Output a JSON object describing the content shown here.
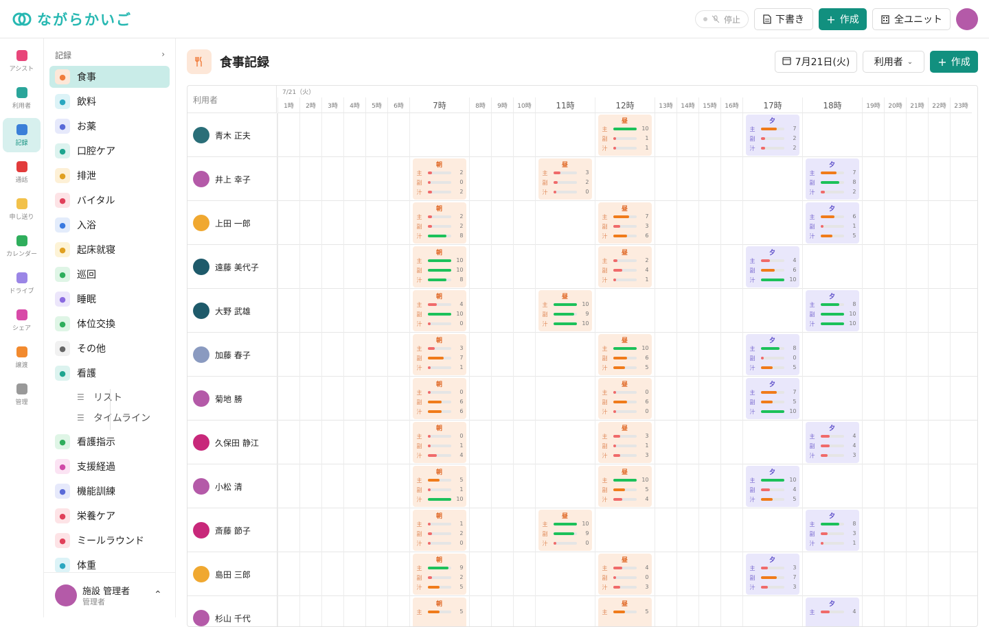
{
  "app": {
    "name": "ながらかいご"
  },
  "topbar": {
    "stop_label": "停止",
    "draft_label": "下書き",
    "create_label": "作成",
    "unit_label": "全ユニット"
  },
  "rail": [
    {
      "label": "アシスト",
      "icon": "heart-icon",
      "color": "#e8467a"
    },
    {
      "label": "利用者",
      "icon": "users-icon",
      "color": "#2aa59a"
    },
    {
      "label": "記録",
      "icon": "clipboard-icon",
      "color": "#3b7fd8",
      "active": true
    },
    {
      "label": "通話",
      "icon": "phone-icon",
      "color": "#e23b3b"
    },
    {
      "label": "申し送り",
      "icon": "chat-icon",
      "color": "#f2c14a"
    },
    {
      "label": "カレンダー",
      "icon": "calendar-icon",
      "color": "#2fae5c"
    },
    {
      "label": "ドライブ",
      "icon": "folder-icon",
      "color": "#9b86e6"
    },
    {
      "label": "シェア",
      "icon": "share-icon",
      "color": "#d84aa8"
    },
    {
      "label": "譲渡",
      "icon": "box-icon",
      "color": "#f28a2e"
    },
    {
      "label": "管理",
      "icon": "gear-icon",
      "color": "#999999"
    }
  ],
  "menu": {
    "header": "記録",
    "items": [
      {
        "label": "食事",
        "icon": "fork-knife-icon",
        "bg": "#fde7d8",
        "fg": "#f07b3a",
        "active": true
      },
      {
        "label": "飲料",
        "icon": "cup-icon",
        "bg": "#dcf3f7",
        "fg": "#2aa7c0"
      },
      {
        "label": "お薬",
        "icon": "pill-icon",
        "bg": "#e6e9fb",
        "fg": "#5a6ad8"
      },
      {
        "label": "口腔ケア",
        "icon": "toothbrush-icon",
        "bg": "#dcf3ef",
        "fg": "#1ea58f"
      },
      {
        "label": "排泄",
        "icon": "toilet-icon",
        "bg": "#fdf0d6",
        "fg": "#e0a020"
      },
      {
        "label": "バイタル",
        "icon": "heart-pulse-icon",
        "bg": "#fde3e6",
        "fg": "#e0405a"
      },
      {
        "label": "入浴",
        "icon": "bath-icon",
        "bg": "#e3ecfb",
        "fg": "#3a7ae0"
      },
      {
        "label": "起床就寝",
        "icon": "sunrise-icon",
        "bg": "#fdf3d6",
        "fg": "#e0a020"
      },
      {
        "label": "巡回",
        "icon": "shield-icon",
        "bg": "#dff5e6",
        "fg": "#2fae5c"
      },
      {
        "label": "睡眠",
        "icon": "moon-icon",
        "bg": "#ece6fb",
        "fg": "#8a6ae0"
      },
      {
        "label": "体位交換",
        "icon": "rotate-icon",
        "bg": "#dff5e6",
        "fg": "#2fae5c"
      },
      {
        "label": "その他",
        "icon": "more-icon",
        "bg": "#f1f1f1",
        "fg": "#666666"
      },
      {
        "label": "看護",
        "icon": "stethoscope-icon",
        "bg": "#dcf3ef",
        "fg": "#1ea58f"
      }
    ],
    "sub_items": [
      {
        "label": "リスト",
        "icon": "list-icon"
      },
      {
        "label": "タイムライン",
        "icon": "timeline-icon"
      }
    ],
    "items2": [
      {
        "label": "看護指示",
        "icon": "clipboard-check-icon",
        "bg": "#dff5e6",
        "fg": "#2fae5c"
      },
      {
        "label": "支援経過",
        "icon": "edit-icon",
        "bg": "#fbe3f3",
        "fg": "#d04aa8"
      },
      {
        "label": "機能訓練",
        "icon": "footprints-icon",
        "bg": "#e6e9fb",
        "fg": "#5a6ad8"
      },
      {
        "label": "栄養ケア",
        "icon": "apple-icon",
        "bg": "#fde3e6",
        "fg": "#e0405a"
      },
      {
        "label": "ミールラウンド",
        "icon": "pot-icon",
        "bg": "#fde3e6",
        "fg": "#e0405a"
      },
      {
        "label": "体重",
        "icon": "scale-icon",
        "bg": "#dcf3f7",
        "fg": "#2aa7c0"
      }
    ],
    "user": {
      "name": "施設 管理者",
      "role": "管理者"
    }
  },
  "page": {
    "title": "食事記録",
    "date": "7月21日(火)",
    "filter": "利用者",
    "create": "作成"
  },
  "grid": {
    "user_header": "利用者",
    "date_label": "7/21（火）",
    "hours": [
      "1時",
      "2時",
      "3時",
      "4時",
      "5時",
      "6時",
      "7時",
      "8時",
      "9時",
      "10時",
      "11時",
      "12時",
      "13時",
      "14時",
      "15時",
      "16時",
      "17時",
      "18時",
      "19時",
      "20時",
      "21時",
      "22時",
      "23時"
    ],
    "meal_titles": {
      "b": "朝",
      "l": "昼",
      "d": "夕"
    },
    "nutrient_labels": [
      "主",
      "副",
      "汁"
    ],
    "residents": [
      {
        "name": "青木 正夫",
        "avatar": "#2a6e78",
        "meals": [
          {
            "t": "l",
            "h": "12時",
            "v": [
              10,
              1,
              1
            ]
          },
          {
            "t": "d",
            "h": "17時",
            "v": [
              7,
              2,
              2
            ]
          }
        ]
      },
      {
        "name": "井上 幸子",
        "avatar": "#b45aa8",
        "meals": [
          {
            "t": "b",
            "h": "7時",
            "v": [
              2,
              0,
              2
            ]
          },
          {
            "t": "l",
            "h": "11時",
            "v": [
              3,
              2,
              0
            ]
          },
          {
            "t": "d",
            "h": "18時",
            "v": [
              7,
              8,
              2
            ]
          }
        ]
      },
      {
        "name": "上田 一郎",
        "avatar": "#f0a830",
        "meals": [
          {
            "t": "b",
            "h": "7時",
            "v": [
              2,
              2,
              8
            ]
          },
          {
            "t": "l",
            "h": "12時",
            "v": [
              7,
              3,
              6
            ]
          },
          {
            "t": "d",
            "h": "18時",
            "v": [
              6,
              1,
              5
            ]
          }
        ]
      },
      {
        "name": "遠藤 美代子",
        "avatar": "#1e5a6a",
        "meals": [
          {
            "t": "b",
            "h": "7時",
            "v": [
              10,
              10,
              8
            ]
          },
          {
            "t": "l",
            "h": "12時",
            "v": [
              2,
              4,
              1
            ]
          },
          {
            "t": "d",
            "h": "17時",
            "v": [
              4,
              6,
              10
            ]
          }
        ]
      },
      {
        "name": "大野 武雄",
        "avatar": "#1e5a6a",
        "meals": [
          {
            "t": "b",
            "h": "7時",
            "v": [
              4,
              10,
              0
            ]
          },
          {
            "t": "l",
            "h": "11時",
            "v": [
              10,
              9,
              10
            ]
          },
          {
            "t": "d",
            "h": "18時",
            "v": [
              8,
              10,
              10
            ]
          }
        ]
      },
      {
        "name": "加藤 春子",
        "avatar": "#8a9ac0",
        "meals": [
          {
            "t": "b",
            "h": "7時",
            "v": [
              3,
              7,
              1
            ]
          },
          {
            "t": "l",
            "h": "12時",
            "v": [
              10,
              6,
              5
            ]
          },
          {
            "t": "d",
            "h": "17時",
            "v": [
              8,
              0,
              5
            ]
          }
        ]
      },
      {
        "name": "菊地 勝",
        "avatar": "#b45aa8",
        "meals": [
          {
            "t": "b",
            "h": "7時",
            "v": [
              0,
              6,
              6
            ]
          },
          {
            "t": "l",
            "h": "12時",
            "v": [
              0,
              6,
              0
            ]
          },
          {
            "t": "d",
            "h": "17時",
            "v": [
              7,
              5,
              10
            ]
          }
        ]
      },
      {
        "name": "久保田 静江",
        "avatar": "#c8287a",
        "meals": [
          {
            "t": "b",
            "h": "7時",
            "v": [
              0,
              1,
              4
            ]
          },
          {
            "t": "l",
            "h": "12時",
            "v": [
              3,
              1,
              3
            ]
          },
          {
            "t": "d",
            "h": "18時",
            "v": [
              4,
              4,
              3
            ]
          }
        ]
      },
      {
        "name": "小松 清",
        "avatar": "#b45aa8",
        "meals": [
          {
            "t": "b",
            "h": "7時",
            "v": [
              5,
              1,
              10
            ]
          },
          {
            "t": "l",
            "h": "12時",
            "v": [
              10,
              5,
              4
            ]
          },
          {
            "t": "d",
            "h": "17時",
            "v": [
              10,
              4,
              5
            ]
          }
        ]
      },
      {
        "name": "斎藤 節子",
        "avatar": "#c8287a",
        "meals": [
          {
            "t": "b",
            "h": "7時",
            "v": [
              1,
              2,
              0
            ]
          },
          {
            "t": "l",
            "h": "11時",
            "v": [
              10,
              9,
              0
            ]
          },
          {
            "t": "d",
            "h": "18時",
            "v": [
              8,
              3,
              1
            ]
          }
        ]
      },
      {
        "name": "島田 三郎",
        "avatar": "#f0a830",
        "meals": [
          {
            "t": "b",
            "h": "7時",
            "v": [
              9,
              2,
              5
            ]
          },
          {
            "t": "l",
            "h": "12時",
            "v": [
              4,
              0,
              3
            ]
          },
          {
            "t": "d",
            "h": "17時",
            "v": [
              3,
              7,
              3
            ]
          }
        ]
      },
      {
        "name": "杉山 千代",
        "avatar": "#b45aa8",
        "meals": [
          {
            "t": "b",
            "h": "7時",
            "v": [
              5
            ]
          },
          {
            "t": "l",
            "h": "12時",
            "v": [
              5
            ]
          },
          {
            "t": "d",
            "h": "18時",
            "v": [
              4
            ]
          }
        ]
      }
    ]
  }
}
